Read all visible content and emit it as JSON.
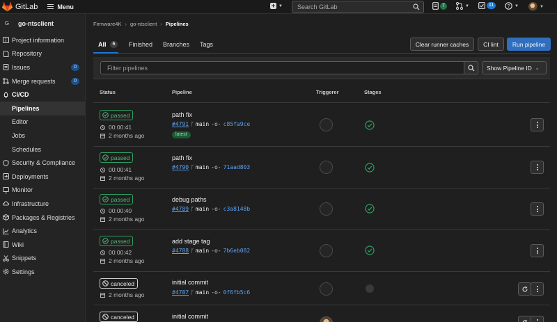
{
  "topbar": {
    "app_name": "GitLab",
    "menu_label": "Menu",
    "search_placeholder": "Search GitLab",
    "issues_count": "7",
    "todos_count": "11",
    "icons": [
      "gitlab-logo",
      "hamburger-icon",
      "plus-icon",
      "search-icon",
      "issues-icon",
      "merge-request-icon",
      "todo-icon",
      "help-icon",
      "avatar"
    ]
  },
  "sidebar": {
    "project_initial": "G",
    "project_name": "go-ntsclient",
    "items": [
      {
        "label": "Project information",
        "icon": "info-icon"
      },
      {
        "label": "Repository",
        "icon": "document-icon"
      },
      {
        "label": "Issues",
        "icon": "issues-icon",
        "count": "0"
      },
      {
        "label": "Merge requests",
        "icon": "merge-request-icon",
        "count": "0"
      },
      {
        "label": "CI/CD",
        "icon": "rocket-icon"
      }
    ],
    "cicd_sub": [
      "Pipelines",
      "Editor",
      "Jobs",
      "Schedules"
    ],
    "items2": [
      {
        "label": "Security & Compliance",
        "icon": "shield-icon"
      },
      {
        "label": "Deployments",
        "icon": "deploy-icon"
      },
      {
        "label": "Monitor",
        "icon": "monitor-icon"
      },
      {
        "label": "Infrastructure",
        "icon": "cloud-icon"
      },
      {
        "label": "Packages & Registries",
        "icon": "package-icon"
      },
      {
        "label": "Analytics",
        "icon": "chart-icon"
      },
      {
        "label": "Wiki",
        "icon": "book-icon"
      },
      {
        "label": "Snippets",
        "icon": "snippet-icon"
      },
      {
        "label": "Settings",
        "icon": "gear-icon"
      }
    ]
  },
  "breadcrumb": [
    "Firmware4K",
    "go-ntsclient",
    "Pipelines"
  ],
  "tabs": {
    "all": "All",
    "all_count": "6",
    "finished": "Finished",
    "branches": "Branches",
    "tags": "Tags"
  },
  "buttons": {
    "clear_cache": "Clear runner caches",
    "ci_lint": "CI lint",
    "run_pipeline": "Run pipeline"
  },
  "filter": {
    "placeholder": "Filter pipelines",
    "select": "Show Pipeline ID"
  },
  "table": {
    "headers": {
      "status": "Status",
      "pipeline": "Pipeline",
      "triggerer": "Triggerer",
      "stages": "Stages"
    },
    "rows": [
      {
        "status": "passed",
        "duration": "00:00:41",
        "finished": "2 months ago",
        "title": "path fix",
        "id": "#4791",
        "branch": "main",
        "commit": "c85fa9ce",
        "tag": "latest"
      },
      {
        "status": "passed",
        "duration": "00:00:41",
        "finished": "2 months ago",
        "title": "path fix",
        "id": "#4790",
        "branch": "main",
        "commit": "71aad803"
      },
      {
        "status": "passed",
        "duration": "00:00:40",
        "finished": "2 months ago",
        "title": "debug paths",
        "id": "#4789",
        "branch": "main",
        "commit": "c3a8148b"
      },
      {
        "status": "passed",
        "duration": "00:00:42",
        "finished": "2 months ago",
        "title": "add stage tag",
        "id": "#4788",
        "branch": "main",
        "commit": "7b6eb082"
      },
      {
        "status": "canceled",
        "finished": "2 months ago",
        "title": "initial commit",
        "id": "#4787",
        "branch": "main",
        "commit": "0f6fb5c6"
      },
      {
        "status": "canceled",
        "title": "initial commit"
      }
    ]
  },
  "colors": {
    "passed": "#2da160",
    "link": "#5aa0f0",
    "primary": "#2f6fbd",
    "background": "#1f1f1f"
  }
}
